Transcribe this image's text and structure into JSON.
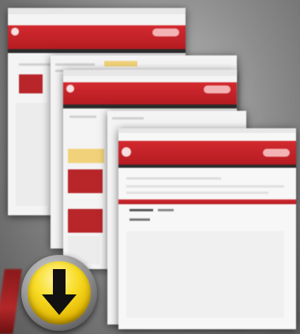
{
  "graphic": {
    "description_free": true,
    "accent_red": "#c9252b",
    "badge_yellow": "#f3d21b",
    "arrow_color": "#111111",
    "icons": [
      "down-arrow-icon"
    ]
  }
}
